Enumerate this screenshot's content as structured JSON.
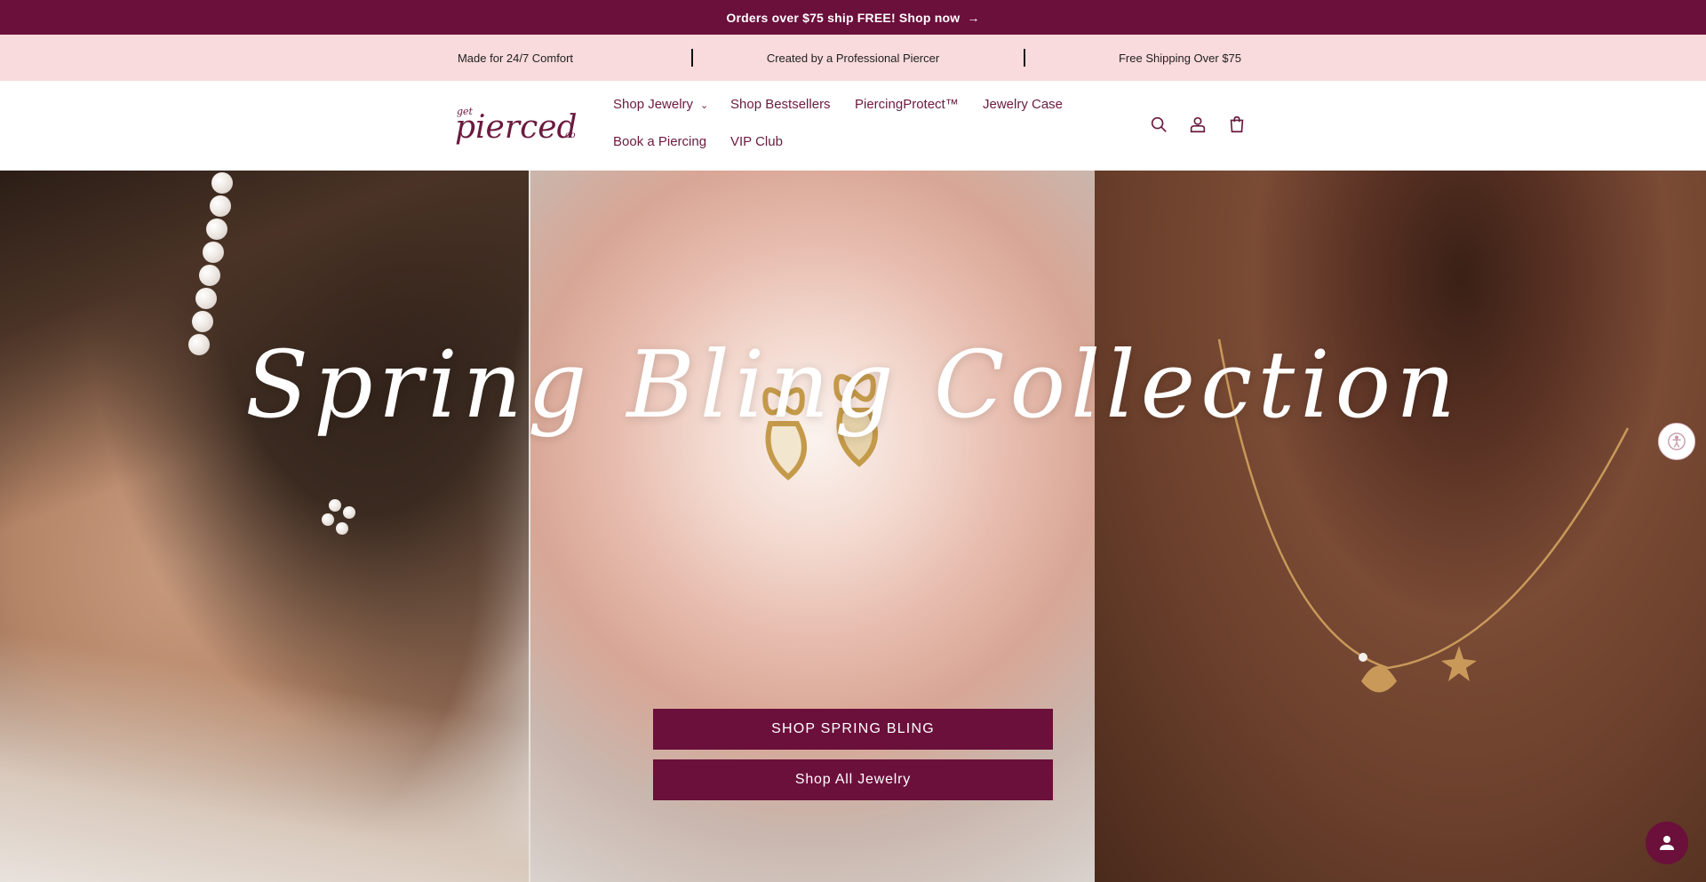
{
  "announcement": {
    "text": "Orders over $75 ship FREE! Shop now",
    "arrow": "→"
  },
  "usp": {
    "items": [
      "Made for 24/7 Comfort",
      "Created by a Professional Piercer",
      "Free Shipping Over $75"
    ]
  },
  "header": {
    "logo_alt": "Get Pierced Co",
    "nav": [
      {
        "label": "Shop Jewelry",
        "has_dropdown": true
      },
      {
        "label": "Shop Bestsellers"
      },
      {
        "label": "PiercingProtect™"
      },
      {
        "label": "Jewelry Case"
      },
      {
        "label": "Book a Piercing"
      },
      {
        "label": "VIP Club"
      }
    ],
    "icons": [
      "search-icon",
      "account-icon",
      "cart-icon"
    ]
  },
  "hero": {
    "headline": "Spring Bling Collection",
    "cta_primary": "SHOP SPRING BLING",
    "cta_secondary": "Shop All Jewelry"
  },
  "colors": {
    "brand": "#6b0f3b",
    "usp_bg": "#fadbdd",
    "nav_text": "#6b1a3f"
  }
}
